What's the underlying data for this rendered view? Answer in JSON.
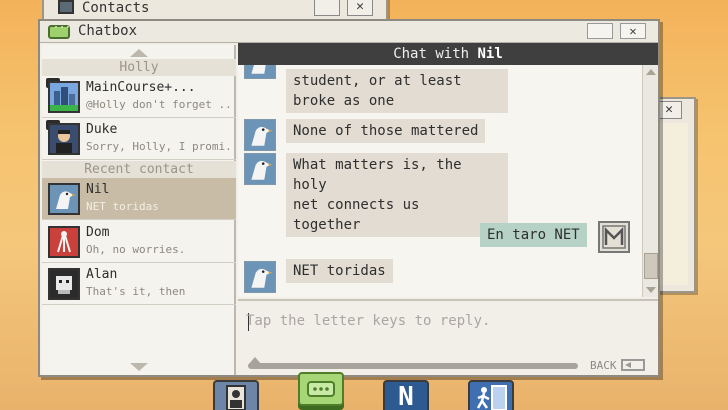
{
  "background_windows": {
    "contacts": {
      "title": "Contacts",
      "close_label": "✕"
    },
    "right": {
      "close_label": "✕"
    }
  },
  "chatbox": {
    "title": "Chatbox",
    "close_label": "✕",
    "header_prefix": "Chat with ",
    "header_name": "Nil"
  },
  "contacts": {
    "group_label": "Holly",
    "recent_label": "Recent contact",
    "pinned": [
      {
        "name": "MainCourse+...",
        "preview": "@Holly don't forget ...",
        "avatar": "city-avatar"
      },
      {
        "name": "Duke",
        "preview": "Sorry, Holly, I promi...",
        "avatar": "duke-avatar"
      }
    ],
    "recent": [
      {
        "name": "Nil",
        "preview": "NET toridas",
        "avatar": "bird-avatar",
        "selected": true
      },
      {
        "name": "Dom",
        "preview": "Oh, no worries.",
        "avatar": "dom-avatar"
      },
      {
        "name": "Alan",
        "preview": "That's it, then",
        "avatar": "alan-avatar"
      }
    ]
  },
  "messages": [
    {
      "from": "Nil",
      "lines": [
        "student, or at least",
        "broke as one"
      ]
    },
    {
      "from": "Nil",
      "lines": [
        "None of those mattered"
      ]
    },
    {
      "from": "Nil",
      "lines": [
        "What matters is, the holy",
        "net connects us",
        "together"
      ]
    },
    {
      "from": "me",
      "lines": [
        "En taro NET"
      ]
    },
    {
      "from": "Nil",
      "lines": [
        "NET toridas"
      ]
    }
  ],
  "input": {
    "placeholder": "Tap the letter keys to reply.",
    "back_label": "BACK"
  },
  "dock": {
    "net_label": "N"
  },
  "colors": {
    "my_bubble": "#b6d2c6",
    "their_bubble": "#e2dcd2",
    "selected_contact": "#c8bca6",
    "header_bg": "#3f3f3f"
  }
}
